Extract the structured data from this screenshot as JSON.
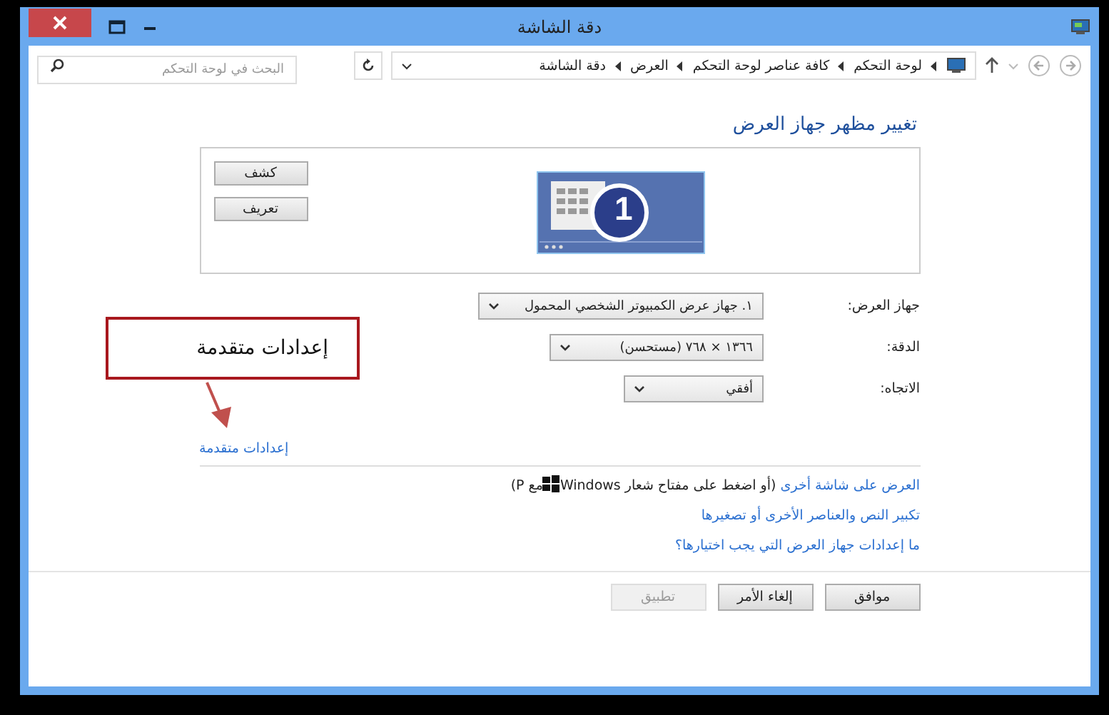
{
  "window": {
    "title": "دقة الشاشة"
  },
  "address_bar": {
    "breadcrumb": [
      "لوحة التحكم",
      "كافة عناصر لوحة التحكم",
      "العرض",
      "دقة الشاشة"
    ],
    "search": {
      "placeholder": "البحث في لوحة التحكم"
    }
  },
  "heading": "تغيير مظهر جهاز العرض",
  "monitor_panel": {
    "buttons": [
      "كشف",
      "تعريف"
    ],
    "display_number": "1"
  },
  "fields": [
    {
      "label": "جهاز العرض:",
      "value": "١. جهاز عرض الكمبيوتر الشخصي المحمول"
    },
    {
      "label": "الدقة:",
      "value": "١٣٦٦ × ٧٦٨ (مستحسن)"
    },
    {
      "label": "الاتجاه:",
      "value": "أفقي"
    }
  ],
  "advanced_link": "إعدادات متقدمة",
  "callout": "إعدادات متقدمة",
  "links": [
    {
      "link": "العرض على شاشة أخرى",
      "rest_before": " (أو اضغط على مفتاح شعار Windows",
      "rest_after": "مع P)"
    },
    {
      "link": "تكبير النص والعناصر الأخرى أو تصغيرها"
    },
    {
      "link": "ما إعدادات جهاز العرض التي يجب اختيارها؟"
    }
  ],
  "buttons": [
    {
      "label": "موافق",
      "disabled": false
    },
    {
      "label": "إلغاء الأمر",
      "disabled": false
    },
    {
      "label": "تطبيق",
      "disabled": true
    }
  ]
}
